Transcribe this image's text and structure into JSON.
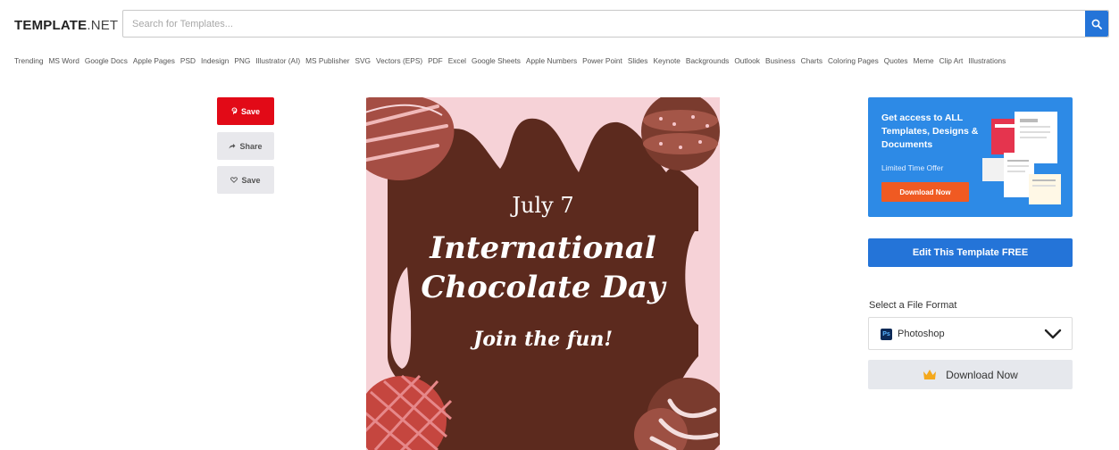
{
  "header": {
    "logo_bold": "TEMPLATE",
    "logo_light": ".NET",
    "search_placeholder": "Search for Templates...",
    "search_icon": "search-icon"
  },
  "categories": [
    "Trending",
    "MS Word",
    "Google Docs",
    "Apple Pages",
    "PSD",
    "Indesign",
    "PNG",
    "Illustrator (AI)",
    "MS Publisher",
    "SVG",
    "Vectors (EPS)",
    "PDF",
    "Excel",
    "Google Sheets",
    "Apple Numbers",
    "Power Point",
    "Slides",
    "Keynote",
    "Backgrounds",
    "Outlook",
    "Business",
    "Charts",
    "Coloring Pages",
    "Quotes",
    "Meme",
    "Clip Art",
    "Illustrations"
  ],
  "social": {
    "pinterest_label": "Save",
    "share_label": "Share",
    "save_label": "Save"
  },
  "preview": {
    "date": "July 7",
    "title_line1": "International",
    "title_line2": "Chocolate Day",
    "subtitle": "Join the fun!"
  },
  "ad": {
    "title": "Get access to ALL Templates, Designs & Documents",
    "offer": "Limited Time Offer",
    "button": "Download Now"
  },
  "sidebar": {
    "edit_button": "Edit This Template FREE",
    "format_label": "Select a File Format",
    "format_value": "Photoshop",
    "format_icon_text": "Ps",
    "download_button": "Download Now"
  },
  "colors": {
    "accent": "#2474d8",
    "pinterest": "#e20a17",
    "chocolate": "#5c2a1e",
    "pink": "#f6d2d7",
    "ad_orange": "#f05a22"
  }
}
